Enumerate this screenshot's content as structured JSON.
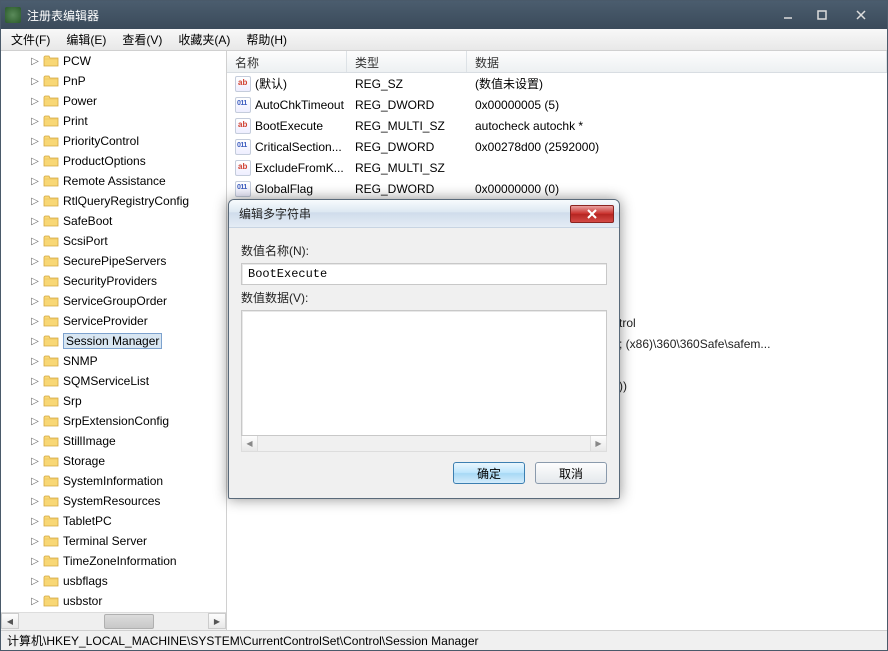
{
  "window": {
    "title": "注册表编辑器"
  },
  "menu": {
    "file": "文件(F)",
    "edit": "编辑(E)",
    "view": "查看(V)",
    "favorites": "收藏夹(A)",
    "help": "帮助(H)"
  },
  "tree": {
    "items": [
      "PCW",
      "PnP",
      "Power",
      "Print",
      "PriorityControl",
      "ProductOptions",
      "Remote Assistance",
      "RtlQueryRegistryConfig",
      "SafeBoot",
      "ScsiPort",
      "SecurePipeServers",
      "SecurityProviders",
      "ServiceGroupOrder",
      "ServiceProvider",
      "Session Manager",
      "SNMP",
      "SQMServiceList",
      "Srp",
      "SrpExtensionConfig",
      "StillImage",
      "Storage",
      "SystemInformation",
      "SystemResources",
      "TabletPC",
      "Terminal Server",
      "TimeZoneInformation",
      "usbflags",
      "usbstor"
    ],
    "selected_index": 14
  },
  "list": {
    "columns": {
      "name": "名称",
      "type": "类型",
      "data": "数据"
    },
    "rows": [
      {
        "icon": "sz",
        "name": "(默认)",
        "type": "REG_SZ",
        "data": "(数值未设置)"
      },
      {
        "icon": "dw",
        "name": "AutoChkTimeout",
        "type": "REG_DWORD",
        "data": "0x00000005 (5)"
      },
      {
        "icon": "sz",
        "name": "BootExecute",
        "type": "REG_MULTI_SZ",
        "data": "autocheck autochk *"
      },
      {
        "icon": "dw",
        "name": "CriticalSection...",
        "type": "REG_DWORD",
        "data": "0x00278d00 (2592000)"
      },
      {
        "icon": "sz",
        "name": "ExcludeFromK...",
        "type": "REG_MULTI_SZ",
        "data": ""
      },
      {
        "icon": "dw",
        "name": "GlobalFlag",
        "type": "REG_DWORD",
        "data": "0x00000000 (0)"
      }
    ],
    "partial_rows": [
      {
        "tail": "trol"
      },
      {
        "tail": "; (x86)\\360\\360Safe\\safem..."
      },
      {
        "tail": ""
      },
      {
        "tail": "))"
      }
    ]
  },
  "dialog": {
    "title": "编辑多字符串",
    "name_label": "数值名称(N):",
    "name_value": "BootExecute",
    "data_label": "数值数据(V):",
    "data_value": "",
    "ok": "确定",
    "cancel": "取消"
  },
  "statusbar": {
    "path": "计算机\\HKEY_LOCAL_MACHINE\\SYSTEM\\CurrentControlSet\\Control\\Session Manager"
  }
}
